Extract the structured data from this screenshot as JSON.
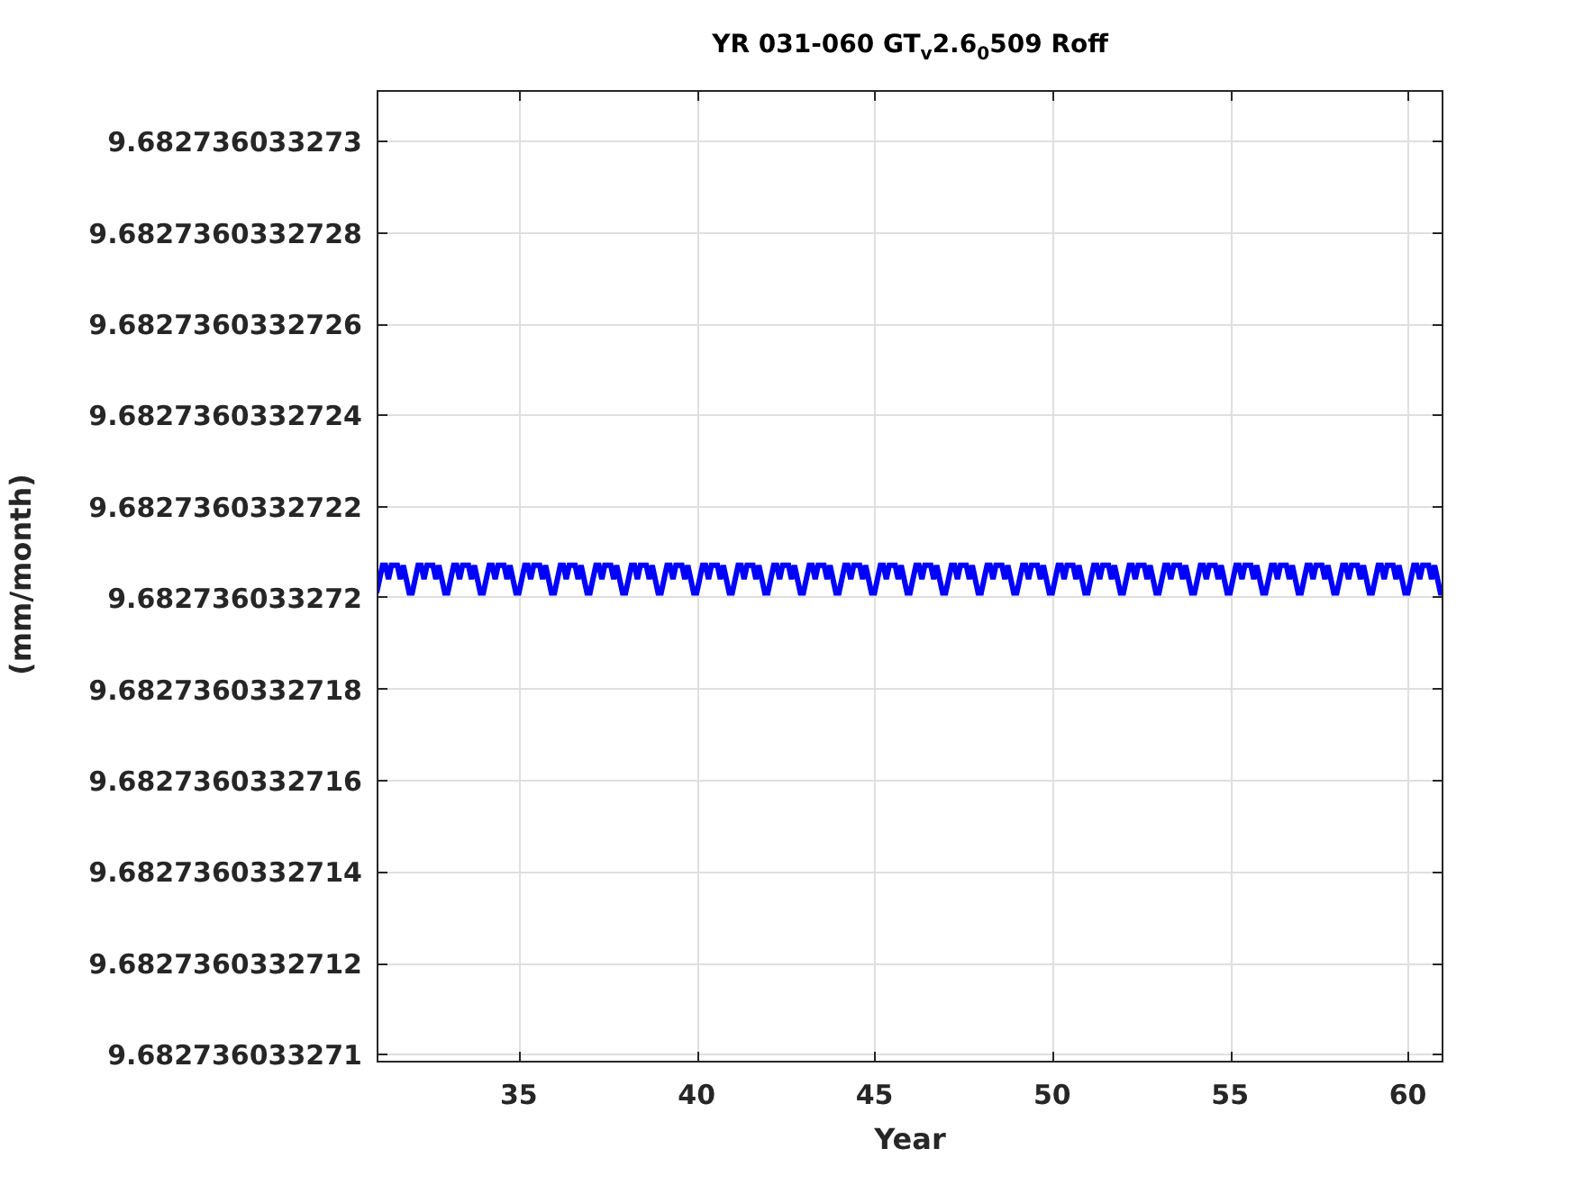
{
  "figure": {
    "chart_data": {
      "type": "line",
      "title": "YR 031-060 GT$_{v}$2.6$_{0}$509 Roff",
      "xlabel": "Year",
      "ylabel": "(mm/month)",
      "grid": true,
      "xlim": [
        31,
        61
      ],
      "ylim": [
        9.68273603327098,
        9.68273603327311
      ],
      "xticks": [
        35,
        40,
        45,
        50,
        55,
        60
      ],
      "yticks": [
        {
          "value": 9.682736033271,
          "label": "9.682736033271"
        },
        {
          "value": 9.6827360332712,
          "label": "9.6827360332712"
        },
        {
          "value": 9.6827360332714,
          "label": "9.6827360332714"
        },
        {
          "value": 9.6827360332716,
          "label": "9.6827360332716"
        },
        {
          "value": 9.6827360332718,
          "label": "9.6827360332718"
        },
        {
          "value": 9.682736033272,
          "label": "9.682736033272"
        },
        {
          "value": 9.6827360332722,
          "label": "9.6827360332722"
        },
        {
          "value": 9.6827360332724,
          "label": "9.6827360332724"
        },
        {
          "value": 9.6827360332726,
          "label": "9.6827360332726"
        },
        {
          "value": 9.6827360332728,
          "label": "9.6827360332728"
        },
        {
          "value": 9.682736033273,
          "label": "9.682736033273"
        }
      ],
      "x": [
        31,
        31.0833,
        31.1667,
        31.25,
        31.3333,
        31.4167,
        31.5,
        31.5833,
        31.6667,
        31.75,
        31.8333,
        31.9167,
        32,
        32.0833,
        32.1667,
        32.25,
        32.3333,
        32.4167,
        32.5,
        32.5833,
        32.6667,
        32.75,
        32.8333,
        32.9167,
        33,
        33.0833,
        33.1667,
        33.25,
        33.3333,
        33.4167,
        33.5,
        33.5833,
        33.6667,
        33.75,
        33.8333,
        33.9167,
        34,
        34.0833,
        34.1667,
        34.25,
        34.3333,
        34.4167,
        34.5,
        34.5833,
        34.6667,
        34.75,
        34.8333,
        34.9167,
        35,
        35.0833,
        35.1667,
        35.25,
        35.3333,
        35.4167,
        35.5,
        35.5833,
        35.6667,
        35.75,
        35.8333,
        35.9167,
        36,
        36.0833,
        36.1667,
        36.25,
        36.3333,
        36.4167,
        36.5,
        36.5833,
        36.6667,
        36.75,
        36.8333,
        36.9167,
        37,
        37.0833,
        37.1667,
        37.25,
        37.3333,
        37.4167,
        37.5,
        37.5833,
        37.6667,
        37.75,
        37.8333,
        37.9167,
        38,
        38.0833,
        38.1667,
        38.25,
        38.3333,
        38.4167,
        38.5,
        38.5833,
        38.6667,
        38.75,
        38.8333,
        38.9167,
        39,
        39.0833,
        39.1667,
        39.25,
        39.3333,
        39.4167,
        39.5,
        39.5833,
        39.6667,
        39.75,
        39.8333,
        39.9167,
        40,
        40.0833,
        40.1667,
        40.25,
        40.3333,
        40.4167,
        40.5,
        40.5833,
        40.6667,
        40.75,
        40.8333,
        40.9167,
        41,
        41.0833,
        41.1667,
        41.25,
        41.3333,
        41.4167,
        41.5,
        41.5833,
        41.6667,
        41.75,
        41.8333,
        41.9167,
        42,
        42.0833,
        42.1667,
        42.25,
        42.3333,
        42.4167,
        42.5,
        42.5833,
        42.6667,
        42.75,
        42.8333,
        42.9167,
        43,
        43.0833,
        43.1667,
        43.25,
        43.3333,
        43.4167,
        43.5,
        43.5833,
        43.6667,
        43.75,
        43.8333,
        43.9167,
        44,
        44.0833,
        44.1667,
        44.25,
        44.3333,
        44.4167,
        44.5,
        44.5833,
        44.6667,
        44.75,
        44.8333,
        44.9167,
        45,
        45.0833,
        45.1667,
        45.25,
        45.3333,
        45.4167,
        45.5,
        45.5833,
        45.6667,
        45.75,
        45.8333,
        45.9167,
        46,
        46.0833,
        46.1667,
        46.25,
        46.3333,
        46.4167,
        46.5,
        46.5833,
        46.6667,
        46.75,
        46.8333,
        46.9167,
        47,
        47.0833,
        47.1667,
        47.25,
        47.3333,
        47.4167,
        47.5,
        47.5833,
        47.6667,
        47.75,
        47.8333,
        47.9167,
        48,
        48.0833,
        48.1667,
        48.25,
        48.3333,
        48.4167,
        48.5,
        48.5833,
        48.6667,
        48.75,
        48.8333,
        48.9167,
        49,
        49.0833,
        49.1667,
        49.25,
        49.3333,
        49.4167,
        49.5,
        49.5833,
        49.6667,
        49.75,
        49.8333,
        49.9167,
        50,
        50.0833,
        50.1667,
        50.25,
        50.3333,
        50.4167,
        50.5,
        50.5833,
        50.6667,
        50.75,
        50.8333,
        50.9167,
        51,
        51.0833,
        51.1667,
        51.25,
        51.3333,
        51.4167,
        51.5,
        51.5833,
        51.6667,
        51.75,
        51.8333,
        51.9167,
        52,
        52.0833,
        52.1667,
        52.25,
        52.3333,
        52.4167,
        52.5,
        52.5833,
        52.6667,
        52.75,
        52.8333,
        52.9167,
        53,
        53.0833,
        53.1667,
        53.25,
        53.3333,
        53.4167,
        53.5,
        53.5833,
        53.6667,
        53.75,
        53.8333,
        53.9167,
        54,
        54.0833,
        54.1667,
        54.25,
        54.3333,
        54.4167,
        54.5,
        54.5833,
        54.6667,
        54.75,
        54.8333,
        54.9167,
        55,
        55.0833,
        55.1667,
        55.25,
        55.3333,
        55.4167,
        55.5,
        55.5833,
        55.6667,
        55.75,
        55.8333,
        55.9167,
        56,
        56.0833,
        56.1667,
        56.25,
        56.3333,
        56.4167,
        56.5,
        56.5833,
        56.6667,
        56.75,
        56.8333,
        56.9167,
        57,
        57.0833,
        57.1667,
        57.25,
        57.3333,
        57.4167,
        57.5,
        57.5833,
        57.6667,
        57.75,
        57.8333,
        57.9167,
        58,
        58.0833,
        58.1667,
        58.25,
        58.3333,
        58.4167,
        58.5,
        58.5833,
        58.6667,
        58.75,
        58.8333,
        58.9167,
        59,
        59.0833,
        59.1667,
        59.25,
        59.3333,
        59.4167,
        59.5,
        59.5833,
        59.6667,
        59.75,
        59.8333,
        59.9167,
        60,
        60.0833,
        60.1667,
        60.25,
        60.3333,
        60.4167,
        60.5,
        60.5833,
        60.6667,
        60.75,
        60.8333,
        60.9167,
        61
      ],
      "series": [
        {
          "color": "#0000ff",
          "values": [
            9.68273603327201,
            9.68273603327204,
            9.68273603327207,
            9.68273603327207,
            9.68273603327204,
            9.68273603327207,
            9.68273603327207,
            9.68273603327207,
            9.68273603327204,
            9.68273603327207,
            9.68273603327204,
            9.68273603327201,
            9.68273603327201,
            9.68273603327204,
            9.68273603327207,
            9.68273603327207,
            9.68273603327204,
            9.68273603327207,
            9.68273603327207,
            9.68273603327207,
            9.68273603327204,
            9.68273603327207,
            9.68273603327204,
            9.68273603327201,
            9.68273603327201,
            9.68273603327204,
            9.68273603327207,
            9.68273603327207,
            9.68273603327204,
            9.68273603327207,
            9.68273603327207,
            9.68273603327207,
            9.68273603327204,
            9.68273603327207,
            9.68273603327204,
            9.68273603327201,
            9.68273603327201,
            9.68273603327204,
            9.68273603327207,
            9.68273603327207,
            9.68273603327204,
            9.68273603327207,
            9.68273603327207,
            9.68273603327207,
            9.68273603327204,
            9.68273603327207,
            9.68273603327204,
            9.68273603327201,
            9.68273603327201,
            9.68273603327204,
            9.68273603327207,
            9.68273603327207,
            9.68273603327204,
            9.68273603327207,
            9.68273603327207,
            9.68273603327207,
            9.68273603327204,
            9.68273603327207,
            9.68273603327204,
            9.68273603327201,
            9.68273603327201,
            9.68273603327204,
            9.68273603327207,
            9.68273603327207,
            9.68273603327204,
            9.68273603327207,
            9.68273603327207,
            9.68273603327207,
            9.68273603327204,
            9.68273603327207,
            9.68273603327204,
            9.68273603327201,
            9.68273603327201,
            9.68273603327204,
            9.68273603327207,
            9.68273603327207,
            9.68273603327204,
            9.68273603327207,
            9.68273603327207,
            9.68273603327207,
            9.68273603327204,
            9.68273603327207,
            9.68273603327204,
            9.68273603327201,
            9.68273603327201,
            9.68273603327204,
            9.68273603327207,
            9.68273603327207,
            9.68273603327204,
            9.68273603327207,
            9.68273603327207,
            9.68273603327207,
            9.68273603327204,
            9.68273603327207,
            9.68273603327204,
            9.68273603327201,
            9.68273603327201,
            9.68273603327204,
            9.68273603327207,
            9.68273603327207,
            9.68273603327204,
            9.68273603327207,
            9.68273603327207,
            9.68273603327207,
            9.68273603327204,
            9.68273603327207,
            9.68273603327204,
            9.68273603327201,
            9.68273603327201,
            9.68273603327204,
            9.68273603327207,
            9.68273603327207,
            9.68273603327204,
            9.68273603327207,
            9.68273603327207,
            9.68273603327207,
            9.68273603327204,
            9.68273603327207,
            9.68273603327204,
            9.68273603327201,
            9.68273603327201,
            9.68273603327204,
            9.68273603327207,
            9.68273603327207,
            9.68273603327204,
            9.68273603327207,
            9.68273603327207,
            9.68273603327207,
            9.68273603327204,
            9.68273603327207,
            9.68273603327204,
            9.68273603327201,
            9.68273603327201,
            9.68273603327204,
            9.68273603327207,
            9.68273603327207,
            9.68273603327204,
            9.68273603327207,
            9.68273603327207,
            9.68273603327207,
            9.68273603327204,
            9.68273603327207,
            9.68273603327204,
            9.68273603327201,
            9.68273603327201,
            9.68273603327204,
            9.68273603327207,
            9.68273603327207,
            9.68273603327204,
            9.68273603327207,
            9.68273603327207,
            9.68273603327207,
            9.68273603327204,
            9.68273603327207,
            9.68273603327204,
            9.68273603327201,
            9.68273603327201,
            9.68273603327204,
            9.68273603327207,
            9.68273603327207,
            9.68273603327204,
            9.68273603327207,
            9.68273603327207,
            9.68273603327207,
            9.68273603327204,
            9.68273603327207,
            9.68273603327204,
            9.68273603327201,
            9.68273603327201,
            9.68273603327204,
            9.68273603327207,
            9.68273603327207,
            9.68273603327204,
            9.68273603327207,
            9.68273603327207,
            9.68273603327207,
            9.68273603327204,
            9.68273603327207,
            9.68273603327204,
            9.68273603327201,
            9.68273603327201,
            9.68273603327204,
            9.68273603327207,
            9.68273603327207,
            9.68273603327204,
            9.68273603327207,
            9.68273603327207,
            9.68273603327207,
            9.68273603327204,
            9.68273603327207,
            9.68273603327204,
            9.68273603327201,
            9.68273603327201,
            9.68273603327204,
            9.68273603327207,
            9.68273603327207,
            9.68273603327204,
            9.68273603327207,
            9.68273603327207,
            9.68273603327207,
            9.68273603327204,
            9.68273603327207,
            9.68273603327204,
            9.68273603327201,
            9.68273603327201,
            9.68273603327204,
            9.68273603327207,
            9.68273603327207,
            9.68273603327204,
            9.68273603327207,
            9.68273603327207,
            9.68273603327207,
            9.68273603327204,
            9.68273603327207,
            9.68273603327204,
            9.68273603327201,
            9.68273603327201,
            9.68273603327204,
            9.68273603327207,
            9.68273603327207,
            9.68273603327204,
            9.68273603327207,
            9.68273603327207,
            9.68273603327207,
            9.68273603327204,
            9.68273603327207,
            9.68273603327204,
            9.68273603327201,
            9.68273603327201,
            9.68273603327204,
            9.68273603327207,
            9.68273603327207,
            9.68273603327204,
            9.68273603327207,
            9.68273603327207,
            9.68273603327207,
            9.68273603327204,
            9.68273603327207,
            9.68273603327204,
            9.68273603327201,
            9.68273603327201,
            9.68273603327204,
            9.68273603327207,
            9.68273603327207,
            9.68273603327204,
            9.68273603327207,
            9.68273603327207,
            9.68273603327207,
            9.68273603327204,
            9.68273603327207,
            9.68273603327204,
            9.68273603327201,
            9.68273603327201,
            9.68273603327204,
            9.68273603327207,
            9.68273603327207,
            9.68273603327204,
            9.68273603327207,
            9.68273603327207,
            9.68273603327207,
            9.68273603327204,
            9.68273603327207,
            9.68273603327204,
            9.68273603327201,
            9.68273603327201,
            9.68273603327204,
            9.68273603327207,
            9.68273603327207,
            9.68273603327204,
            9.68273603327207,
            9.68273603327207,
            9.68273603327207,
            9.68273603327204,
            9.68273603327207,
            9.68273603327204,
            9.68273603327201,
            9.68273603327201,
            9.68273603327204,
            9.68273603327207,
            9.68273603327207,
            9.68273603327204,
            9.68273603327207,
            9.68273603327207,
            9.68273603327207,
            9.68273603327204,
            9.68273603327207,
            9.68273603327204,
            9.68273603327201,
            9.68273603327201,
            9.68273603327204,
            9.68273603327207,
            9.68273603327207,
            9.68273603327204,
            9.68273603327207,
            9.68273603327207,
            9.68273603327207,
            9.68273603327204,
            9.68273603327207,
            9.68273603327204,
            9.68273603327201,
            9.68273603327201,
            9.68273603327204,
            9.68273603327207,
            9.68273603327207,
            9.68273603327204,
            9.68273603327207,
            9.68273603327207,
            9.68273603327207,
            9.68273603327204,
            9.68273603327207,
            9.68273603327204,
            9.68273603327201,
            9.68273603327201,
            9.68273603327204,
            9.68273603327207,
            9.68273603327207,
            9.68273603327204,
            9.68273603327207,
            9.68273603327207,
            9.68273603327207,
            9.68273603327204,
            9.68273603327207,
            9.68273603327204,
            9.68273603327201,
            9.68273603327201,
            9.68273603327204,
            9.68273603327207,
            9.68273603327207,
            9.68273603327204,
            9.68273603327207,
            9.68273603327207,
            9.68273603327207,
            9.68273603327204,
            9.68273603327207,
            9.68273603327204,
            9.68273603327201,
            9.68273603327201,
            9.68273603327204,
            9.68273603327207,
            9.68273603327207,
            9.68273603327204,
            9.68273603327207,
            9.68273603327207,
            9.68273603327207,
            9.68273603327204,
            9.68273603327207,
            9.68273603327204,
            9.68273603327201,
            9.68273603327201,
            9.68273603327204,
            9.68273603327207,
            9.68273603327207,
            9.68273603327204,
            9.68273603327207,
            9.68273603327207,
            9.68273603327207,
            9.68273603327204,
            9.68273603327207,
            9.68273603327204,
            9.68273603327201,
            9.68273603327201
          ]
        }
      ]
    }
  }
}
